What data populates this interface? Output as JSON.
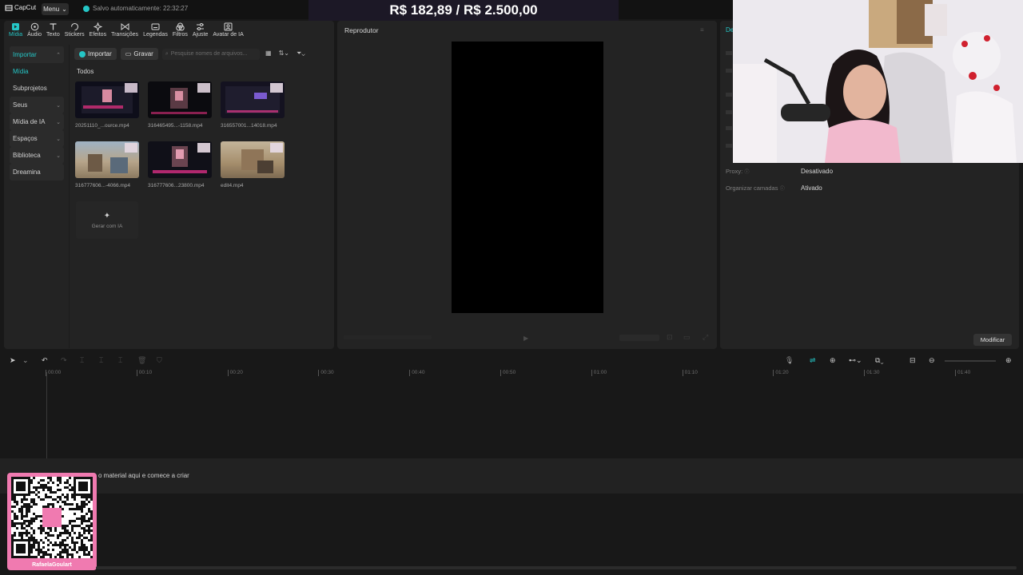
{
  "app": {
    "logo_text": "CapCut",
    "menu_label": "Menu",
    "autosave_text": "Salvo automaticamente: 22:32:27"
  },
  "overlay": {
    "goal_text": "R$ 182,89 / R$ 2.500,00",
    "qr_name": "RafaelaGoulart"
  },
  "tabs": [
    {
      "label": "Mídia",
      "icon": "media-icon"
    },
    {
      "label": "Áudio",
      "icon": "audio-icon"
    },
    {
      "label": "Texto",
      "icon": "text-icon"
    },
    {
      "label": "Stickers",
      "icon": "sticker-icon"
    },
    {
      "label": "Efeitos",
      "icon": "effects-icon"
    },
    {
      "label": "Transições",
      "icon": "transition-icon"
    },
    {
      "label": "Legendas",
      "icon": "captions-icon"
    },
    {
      "label": "Filtros",
      "icon": "filter-icon"
    },
    {
      "label": "Ajuste",
      "icon": "adjust-icon"
    },
    {
      "label": "Avatar de IA",
      "icon": "avatar-icon"
    }
  ],
  "left_nav": {
    "importar": "Importar",
    "midia": "Mídia",
    "subprojetos": "Subprojetos",
    "seus": "Seus",
    "midia_ia": "Mídia de IA",
    "espacos": "Espaços",
    "biblioteca": "Biblioteca",
    "dreamina": "Dreamina"
  },
  "media_toolbar": {
    "import_label": "Importar",
    "record_label": "Gravar",
    "search_placeholder": "Pesquise nomes de arquivos..."
  },
  "media": {
    "section_label": "Todos",
    "clips": [
      {
        "name": "20251110_...ource.mp4"
      },
      {
        "name": "316465495...-1158.mp4"
      },
      {
        "name": "316557001...14018.mp4"
      },
      {
        "name": "316777606...-4066.mp4"
      },
      {
        "name": "316777606...23800.mp4"
      },
      {
        "name": "edit4.mp4"
      }
    ],
    "generate_label": "Gerar com IA"
  },
  "player": {
    "title": "Reprodutor"
  },
  "details": {
    "tab_label": "De",
    "proxy_key": "Proxy:",
    "proxy_value": "Desativado",
    "layers_key": "Organizar camadas",
    "layers_value": "Ativado",
    "modify_label": "Modificar"
  },
  "timeline": {
    "ticks": [
      "00:00",
      "00:10",
      "00:20",
      "00:30",
      "00:40",
      "00:50",
      "01:00",
      "01:10",
      "01:20",
      "01:30",
      "01:40"
    ],
    "hint": "o material aqui e comece a criar"
  },
  "colors": {
    "accent": "#25c6c6",
    "panel": "#232323",
    "background": "#181818"
  }
}
